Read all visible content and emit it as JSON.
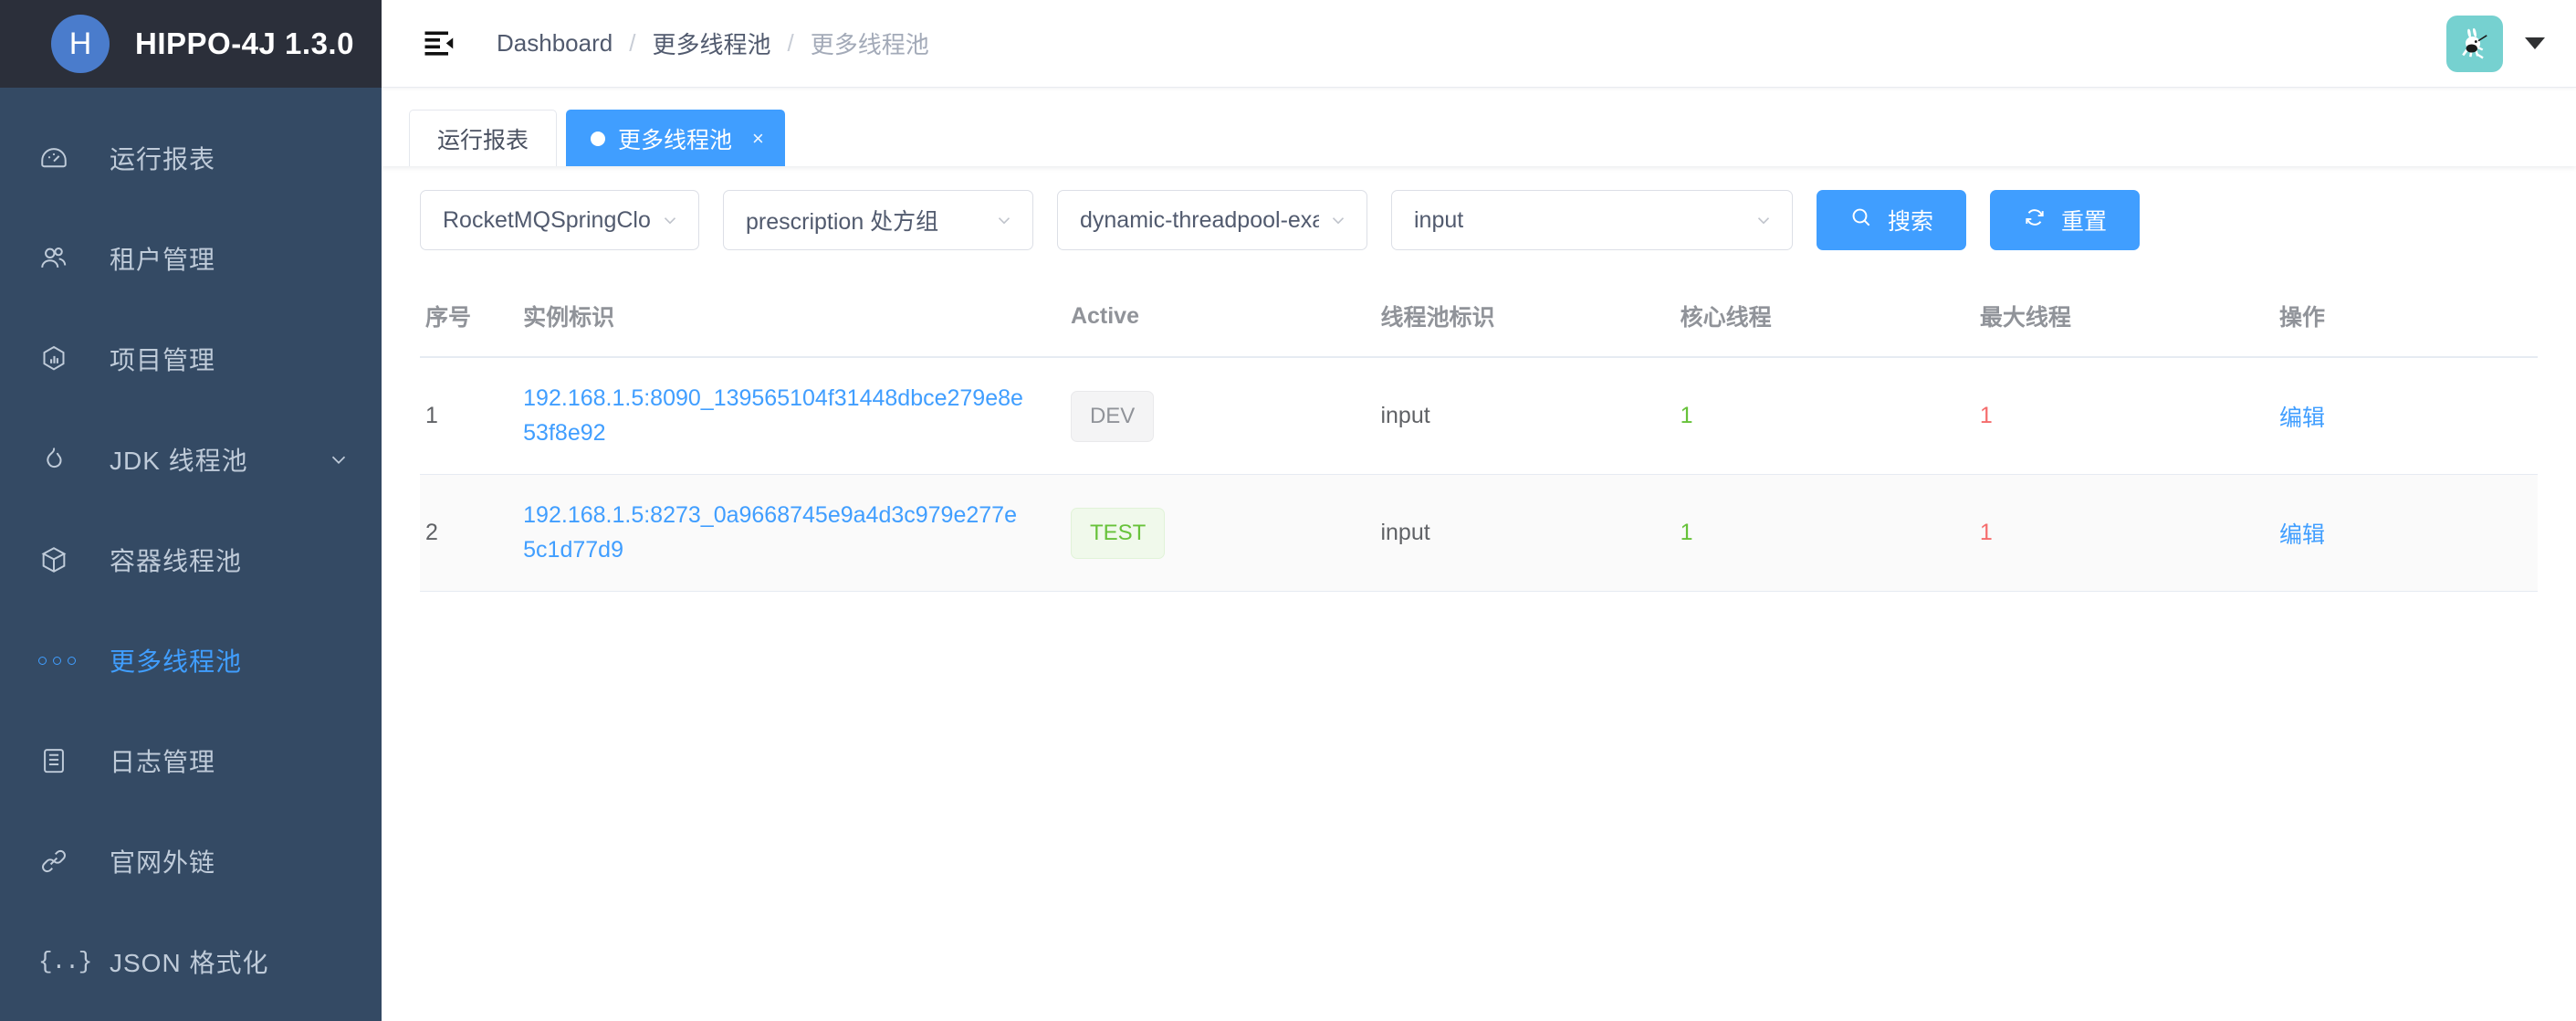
{
  "brand": {
    "logo_letter": "H",
    "title": "HIPPO-4J 1.3.0",
    "logo_color": "#4a7ccc",
    "bar_color": "#2b2f3a"
  },
  "sidebar": {
    "bg_color": "#344a64",
    "active_color": "#409eff",
    "items": [
      {
        "label": "运行报表",
        "icon": "gauge-icon",
        "active": false,
        "expandable": false
      },
      {
        "label": "租户管理",
        "icon": "users-icon",
        "active": false,
        "expandable": false
      },
      {
        "label": "项目管理",
        "icon": "hexagon-chart-icon",
        "active": false,
        "expandable": false
      },
      {
        "label": "JDK 线程池",
        "icon": "flame-icon",
        "active": false,
        "expandable": true
      },
      {
        "label": "容器线程池",
        "icon": "box-icon",
        "active": false,
        "expandable": false
      },
      {
        "label": "更多线程池",
        "icon": "dots-icon",
        "active": true,
        "expandable": false
      },
      {
        "label": "日志管理",
        "icon": "log-icon",
        "active": false,
        "expandable": false
      },
      {
        "label": "官网外链",
        "icon": "link-icon",
        "active": false,
        "expandable": false
      },
      {
        "label": "JSON 格式化",
        "icon": "braces-icon",
        "active": false,
        "expandable": false
      }
    ]
  },
  "topbar": {
    "menu_icon": "hamburger-collapse-icon",
    "breadcrumb": [
      {
        "label": "Dashboard",
        "current": false
      },
      {
        "label": "更多线程池",
        "current": false
      },
      {
        "label": "更多线程池",
        "current": true
      }
    ],
    "separator": "/",
    "avatar_icon": "rabbit-avatar",
    "avatar_bg": "#76d1d0",
    "caret_icon": "caret-down-icon"
  },
  "tabs": [
    {
      "label": "运行报表",
      "active": false,
      "closable": false
    },
    {
      "label": "更多线程池",
      "active": true,
      "closable": true,
      "close_glyph": "×"
    }
  ],
  "filters": {
    "selects": [
      {
        "name": "tenant-select",
        "value": "RocketMQSpringCloudStream",
        "chevron": "chevron-down-icon"
      },
      {
        "name": "project-select",
        "value": "prescription 处方组",
        "chevron": "chevron-down-icon"
      },
      {
        "name": "item-select",
        "value": "dynamic-threadpool-exam",
        "chevron": "chevron-down-icon"
      },
      {
        "name": "threadpool-select",
        "value": "input",
        "chevron": "chevron-down-icon"
      }
    ],
    "search_button": {
      "label": "搜索",
      "icon": "search-icon",
      "color": "#409eff"
    },
    "reset_button": {
      "label": "重置",
      "icon": "refresh-icon",
      "color": "#409eff"
    }
  },
  "table": {
    "columns": [
      "序号",
      "实例标识",
      "Active",
      "线程池标识",
      "核心线程",
      "最大线程",
      "操作"
    ],
    "rows": [
      {
        "index": "1",
        "instance": "192.168.1.5:8090_139565104f31448dbce279e8e53f8e92",
        "active": "DEV",
        "active_style": "dev",
        "pool": "input",
        "core": "1",
        "max": "1",
        "action": "编辑"
      },
      {
        "index": "2",
        "instance": "192.168.1.5:8273_0a9668745e9a4d3c979e277e5c1d77d9",
        "active": "TEST",
        "active_style": "test",
        "pool": "input",
        "core": "1",
        "max": "1",
        "action": "编辑"
      }
    ],
    "colors": {
      "link": "#409eff",
      "core": "#67c23a",
      "max": "#f56c6c",
      "header_text": "#909399"
    }
  }
}
